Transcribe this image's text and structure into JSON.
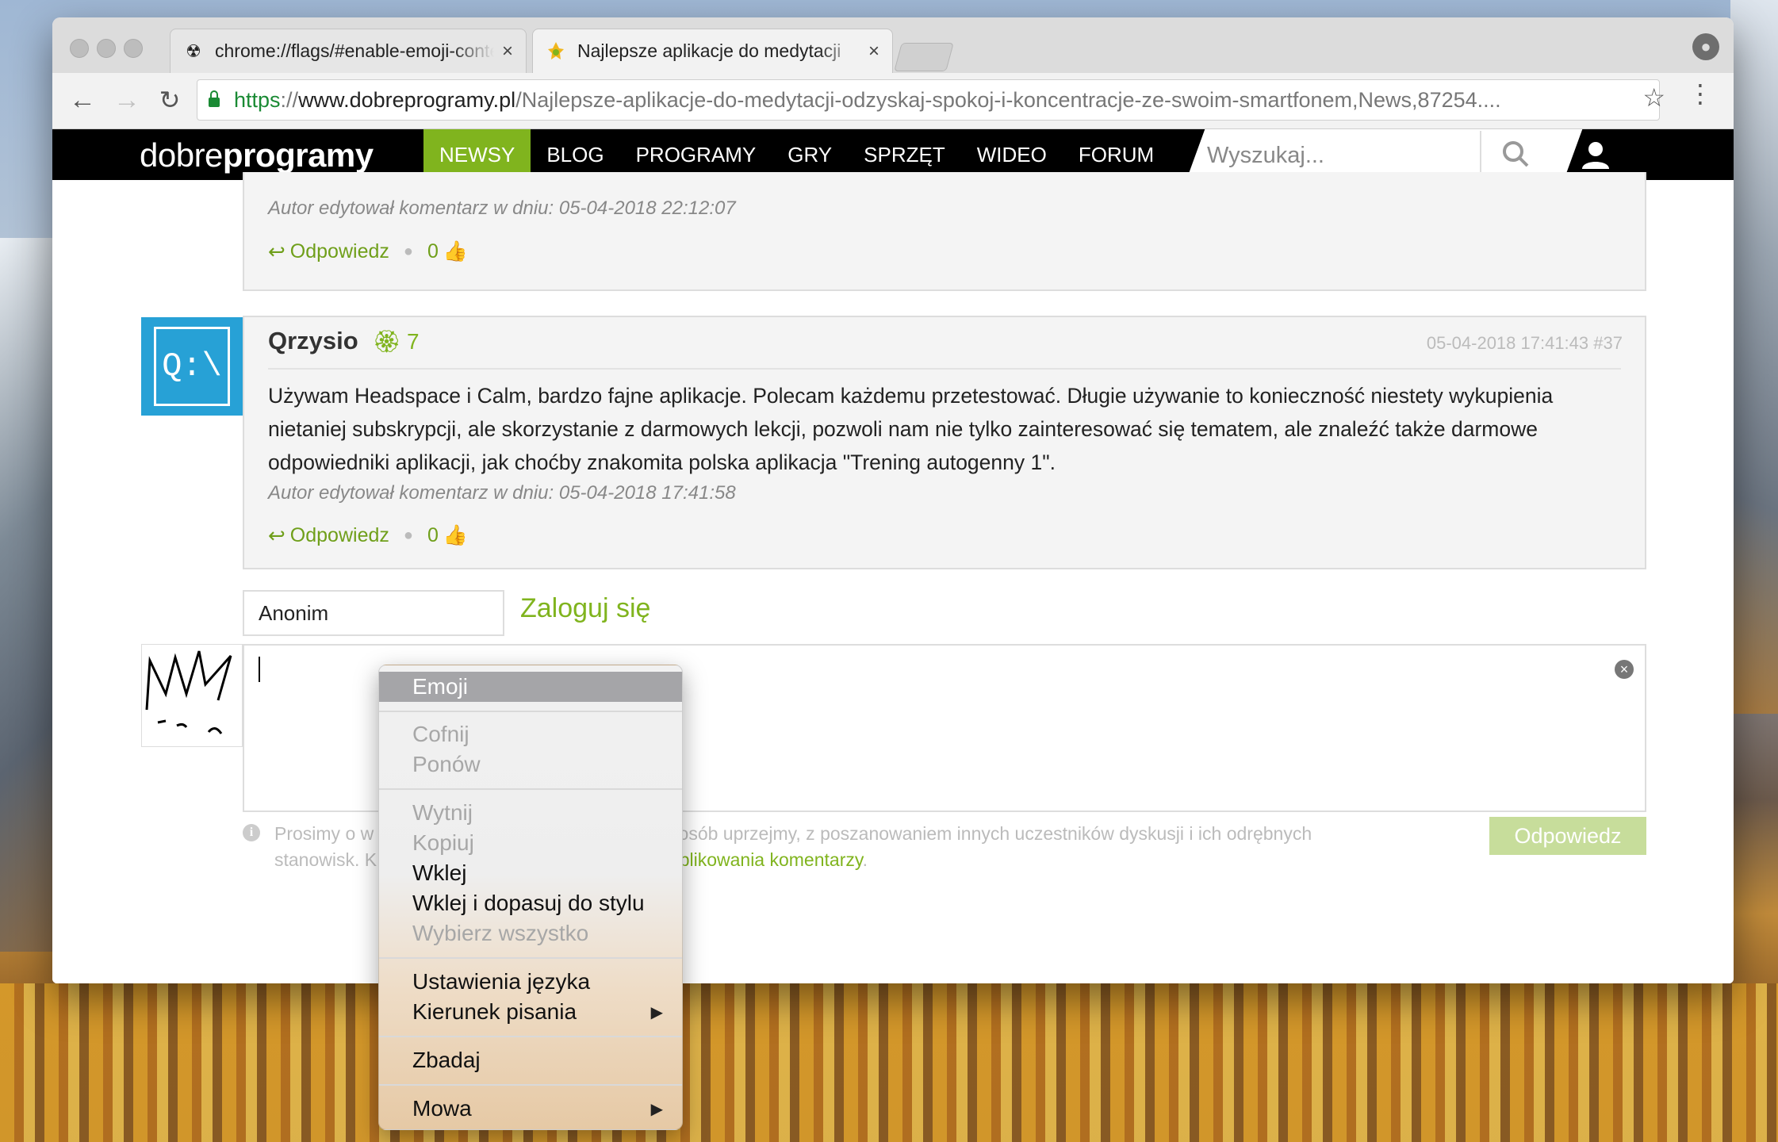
{
  "browser": {
    "tabs": [
      {
        "title": "chrome://flags/#enable-emoji-context-menu",
        "icon": "radiation-icon"
      },
      {
        "title": "Najlepsze aplikacje do medytacji",
        "icon": "dobreprogramy-favicon"
      }
    ],
    "url": {
      "scheme": "https",
      "sep": "://",
      "host": "www.dobreprogramy.pl",
      "path": "/Najlepsze-aplikacje-do-medytacji-odzyskaj-spokoj-i-koncentracje-ze-swoim-smartfonem,News,87254...."
    }
  },
  "site": {
    "logo_light": "dobre",
    "logo_bold": "programy",
    "nav": [
      "NEWSY",
      "BLOG",
      "PROGRAMY",
      "GRY",
      "SPRZĘT",
      "WIDEO",
      "FORUM"
    ],
    "search_placeholder": "Wyszukaj...",
    "accent": "#80b41e"
  },
  "comments": {
    "prev": {
      "edited": "Autor edytował komentarz w dniu: 05-04-2018 22:12:07",
      "reply": "Odpowiedz",
      "likes": "0"
    },
    "current": {
      "author": "Qrzysio",
      "avatar_text": "Q:\\",
      "badge": "7",
      "datetime": "05-04-2018 17:41:43",
      "number": "#37",
      "body": "Używam Headspace i Calm, bardzo fajne aplikacje. Polecam każdemu przetestować. Długie używanie to konieczność niestety wykupienia nietaniej subskrypcji, ale skorzystanie z darmowych lekcji, pozwoli nam nie tylko zainteresować się tematem, ale znaleźć także darmowe odpowiedniki aplikacji, jak choćby znakomita polska aplikacja \"Trening autogenny 1\".",
      "edited": "Autor edytował komentarz w dniu: 05-04-2018 17:41:58",
      "reply": "Odpowiedz",
      "likes": "0"
    }
  },
  "form": {
    "name_value": "Anonim",
    "login": "Zaloguj się",
    "info_part1": "Prosimy o w",
    "info_part2": "sposób uprzejmy, z poszanowaniem innych uczestników dyskusji i ich odrębnych",
    "info_part3": "stanowisk. K",
    "info_link": "publikowania komentarzy",
    "info_end": ".",
    "submit": "Odpowiedz"
  },
  "context_menu": {
    "emoji": "Emoji",
    "undo": "Cofnij",
    "redo": "Ponów",
    "cut": "Wytnij",
    "copy": "Kopiuj",
    "paste": "Wklej",
    "paste_match": "Wklej i dopasuj do stylu",
    "select_all": "Wybierz wszystko",
    "lang_settings": "Ustawienia języka",
    "writing_dir": "Kierunek pisania",
    "inspect": "Zbadaj",
    "speech": "Mowa"
  }
}
